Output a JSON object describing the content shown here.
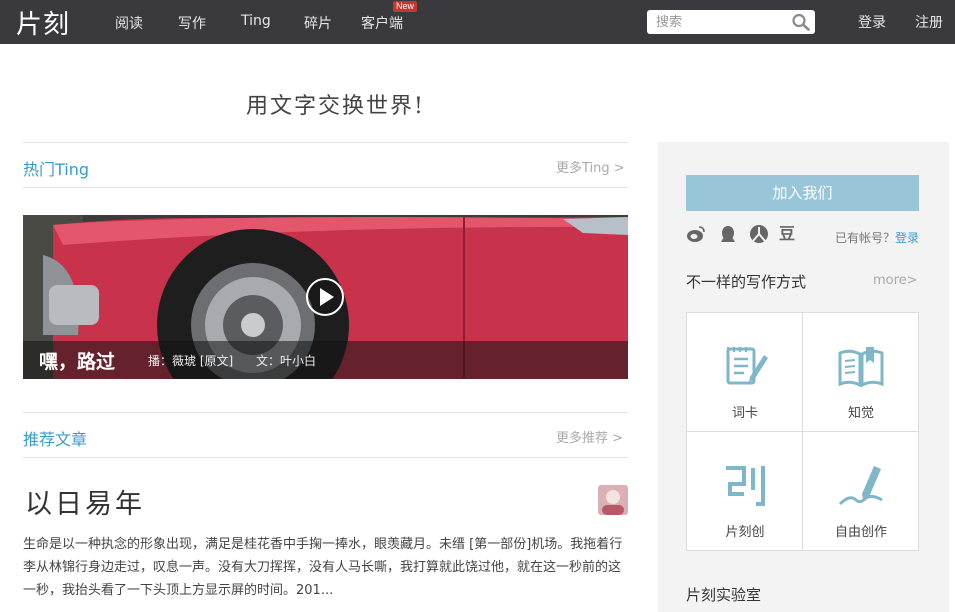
{
  "nav": {
    "logo": "片刻",
    "items": [
      {
        "label": "阅读"
      },
      {
        "label": "写作"
      },
      {
        "label": "Ting"
      },
      {
        "label": "碎片"
      },
      {
        "label": "客户端"
      }
    ],
    "new_badge": "New",
    "search_placeholder": "搜索",
    "login": "登录",
    "register": "注册"
  },
  "slogan": "用文字交换世界!",
  "hot_ting": {
    "title": "热门Ting",
    "more": "更多Ting >",
    "banner": {
      "title": "嘿，路过",
      "anchor": "播：薇琥 [原文]",
      "author": "文：叶小白"
    }
  },
  "recommended": {
    "title": "推荐文章",
    "more": "更多推荐 >",
    "article": {
      "title": "以日易年",
      "body": "生命是以一种执念的形象出现，满足是桂花香中手掬一捧水，眼羡藏月。未缙 [第一部份]机场。我拖着行李从林锦行身边走过，叹息一声。没有大刀挥挥，没有人马长嘶，我打算就此饶过他，就在这一秒前的这一秒，我抬头看了一下头顶上方显示屏的时间。201..."
    }
  },
  "sidebar": {
    "join_button": "加入我们",
    "social_icons": [
      "weibo-icon",
      "qq-icon",
      "renren-icon",
      "douban-icon"
    ],
    "douban_glyph": "豆",
    "has_account": "已有帐号？",
    "login_link": "登录",
    "writing_heading": "不一样的写作方式",
    "writing_more": "more>",
    "writing_tools": [
      {
        "label": "词卡",
        "icon": "notepad-pencil-icon"
      },
      {
        "label": "知觉",
        "icon": "open-book-icon"
      },
      {
        "label": "片刻创",
        "icon": "pianke-logo-icon"
      },
      {
        "label": "自由创作",
        "icon": "pen-signature-icon"
      }
    ],
    "lab_heading": "片刻实验室"
  },
  "colors": {
    "topbar": "#3a3a3e",
    "accent_blue": "#3a9bc9",
    "join_button": "#98c6d8",
    "icon_blue": "#7fb6c8",
    "panel_bg": "#f3f3f3"
  }
}
